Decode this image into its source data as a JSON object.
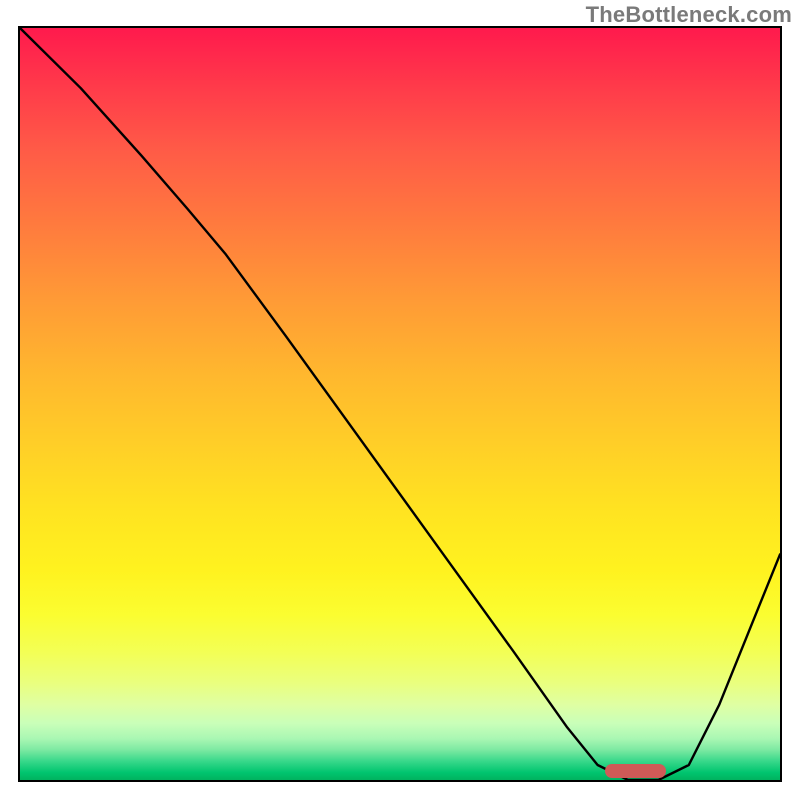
{
  "watermark": "TheBottleneck.com",
  "chart_data": {
    "type": "line",
    "title": "",
    "xlabel": "",
    "ylabel": "",
    "xlim": [
      0,
      100
    ],
    "ylim": [
      0,
      100
    ],
    "background_gradient": {
      "note": "vertical gradient, y=0 is bottom (green), y=100 is top (red)",
      "stops": [
        {
          "y": 0,
          "color": "#00b25f"
        },
        {
          "y": 4,
          "color": "#38d88a"
        },
        {
          "y": 8,
          "color": "#c9ffb9"
        },
        {
          "y": 15,
          "color": "#eaff7d"
        },
        {
          "y": 22,
          "color": "#fbfd30"
        },
        {
          "y": 36,
          "color": "#ffe321"
        },
        {
          "y": 54,
          "color": "#ffb72e"
        },
        {
          "y": 74,
          "color": "#ff7a3e"
        },
        {
          "y": 92,
          "color": "#ff3b4a"
        },
        {
          "y": 100,
          "color": "#ff1a4d"
        }
      ]
    },
    "series": [
      {
        "name": "bottleneck-curve",
        "x": [
          0,
          8,
          16,
          22,
          27,
          35,
          45,
          55,
          65,
          72,
          76,
          80,
          84,
          88,
          92,
          96,
          100
        ],
        "y": [
          100,
          92,
          83,
          76,
          70,
          59,
          45,
          31,
          17,
          7,
          2,
          0,
          0,
          2,
          10,
          20,
          30
        ]
      }
    ],
    "annotations": [
      {
        "name": "optimal-range-bar",
        "shape": "rounded-bar",
        "x_start": 77,
        "x_end": 85,
        "y": 0.5,
        "color": "#cf5a57"
      }
    ]
  }
}
